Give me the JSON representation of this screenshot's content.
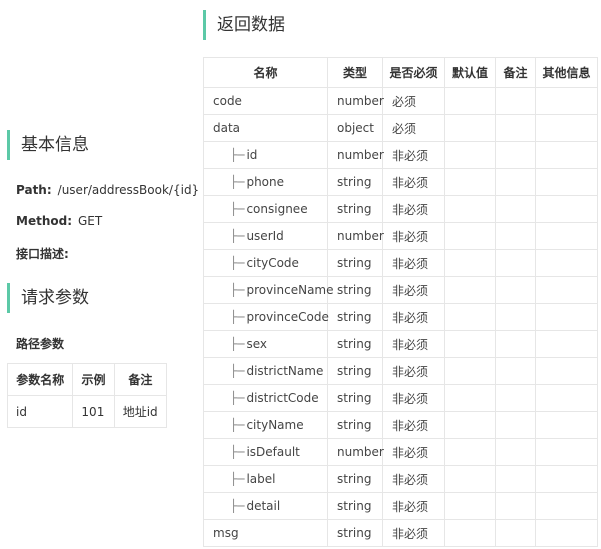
{
  "response_section": {
    "title": "返回数据"
  },
  "basic_section": {
    "title": "基本信息"
  },
  "path": {
    "label": "Path:",
    "value": "/user/addressBook/{id}"
  },
  "method": {
    "label": "Method:",
    "value": "GET"
  },
  "description": {
    "label": "接口描述:"
  },
  "params_section": {
    "title": "请求参数"
  },
  "path_params": {
    "title": "路径参数",
    "headers": [
      "参数名称",
      "示例",
      "备注"
    ],
    "rows": [
      {
        "name": "id",
        "example": "101",
        "remark": "地址id"
      }
    ]
  },
  "response_table": {
    "headers": [
      "名称",
      "类型",
      "是否必须",
      "默认值",
      "备注",
      "其他信息"
    ],
    "tree_prefix": "├─",
    "rows": [
      {
        "name": "code",
        "type": "number",
        "required": "必须"
      },
      {
        "name": "data",
        "type": "object",
        "required": "必须"
      },
      {
        "name": "id",
        "type": "number",
        "required": "非必须"
      },
      {
        "name": "phone",
        "type": "string",
        "required": "非必须"
      },
      {
        "name": "consignee",
        "type": "string",
        "required": "非必须"
      },
      {
        "name": "userId",
        "type": "number",
        "required": "非必须"
      },
      {
        "name": "cityCode",
        "type": "string",
        "required": "非必须"
      },
      {
        "name": "provinceName",
        "type": "string",
        "required": "非必须"
      },
      {
        "name": "provinceCode",
        "type": "string",
        "required": "非必须"
      },
      {
        "name": "sex",
        "type": "string",
        "required": "非必须"
      },
      {
        "name": "districtName",
        "type": "string",
        "required": "非必须"
      },
      {
        "name": "districtCode",
        "type": "string",
        "required": "非必须"
      },
      {
        "name": "cityName",
        "type": "string",
        "required": "非必须"
      },
      {
        "name": "isDefault",
        "type": "number",
        "required": "非必须"
      },
      {
        "name": "label",
        "type": "string",
        "required": "非必须"
      },
      {
        "name": "detail",
        "type": "string",
        "required": "非必须"
      },
      {
        "name": "msg",
        "type": "string",
        "required": "非必须"
      }
    ]
  }
}
